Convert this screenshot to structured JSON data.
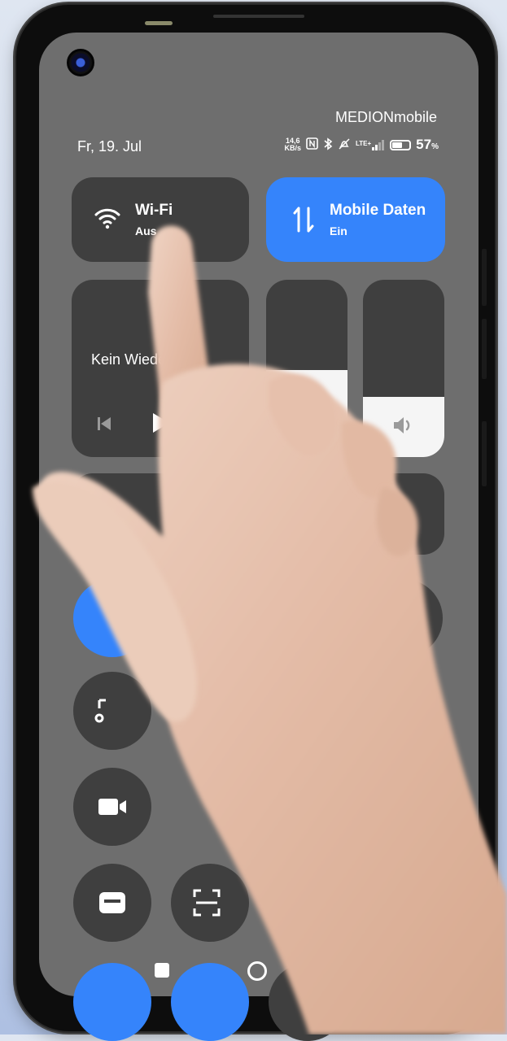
{
  "status_bar": {
    "carrier": "MEDIONmobile",
    "date": "Fr, 19. Jul",
    "net_speed_value": "14,6",
    "net_speed_unit": "KB/s",
    "network_type": "LTE+",
    "battery_percent": "57",
    "battery_suffix": "%"
  },
  "tiles": {
    "wifi": {
      "title": "Wi-Fi",
      "status": "Aus"
    },
    "mobile_data": {
      "title": "Mobile Daten",
      "status": "Ein"
    },
    "media": {
      "text": "Kein Wiedergabe"
    },
    "brightness": {
      "level_percent": 49
    },
    "volume": {
      "level_percent": 34
    }
  },
  "colors": {
    "accent": "#3584fb",
    "panel": "#6e6e6e",
    "tile": "#3f3f3f"
  },
  "icons": [
    "wifi-icon",
    "mobile-data-icon",
    "previous-track-icon",
    "play-icon",
    "volume-icon",
    "camera-video-icon",
    "wallet-icon",
    "scan-icon",
    "home-icon",
    "recents-icon"
  ]
}
